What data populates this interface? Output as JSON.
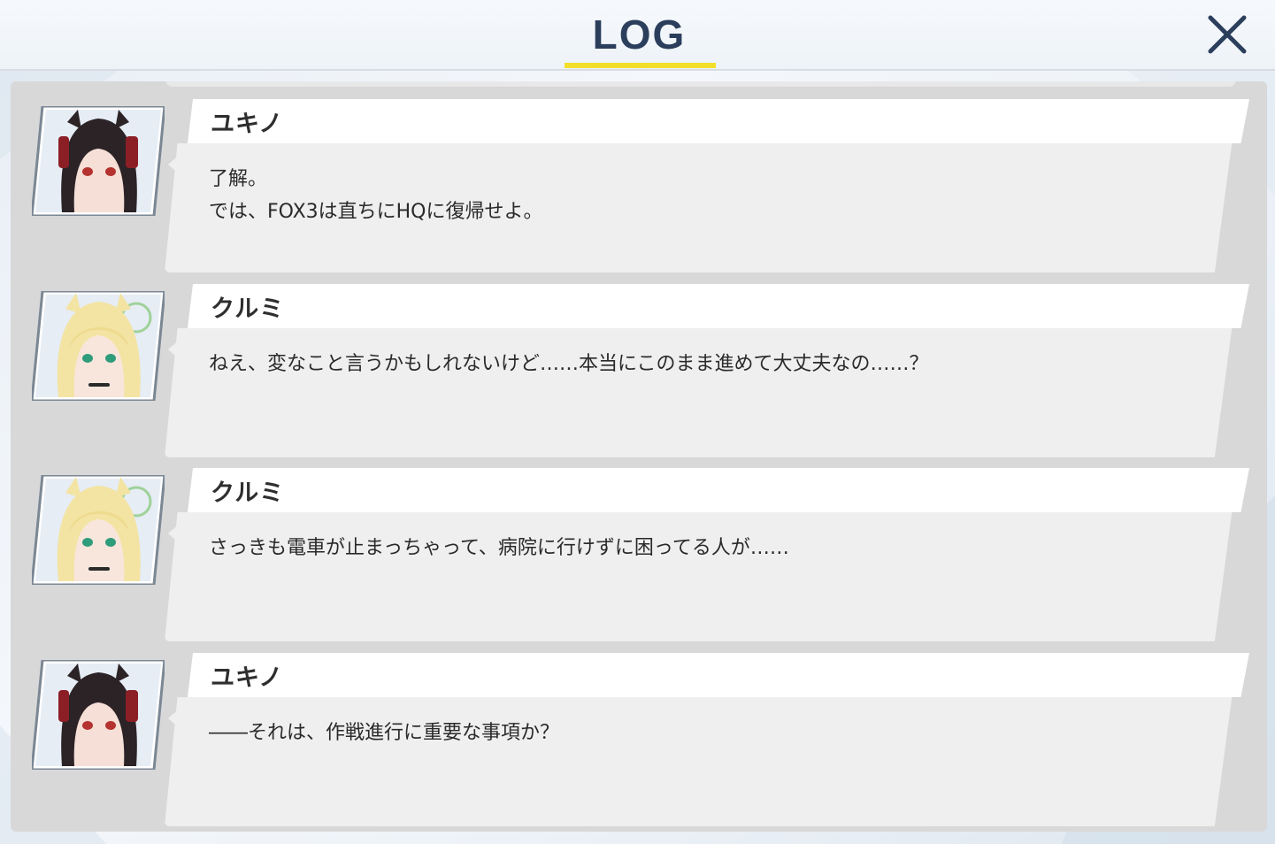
{
  "window": {
    "title": "LOG",
    "close_label": "×",
    "close_icon": "close-icon",
    "accent_color": "#f2df2a",
    "title_color": "#2b3f5c"
  },
  "log": {
    "entries": [
      {
        "speaker": "ユキノ",
        "portrait": "yukino-portrait",
        "message": "了解。\nでは、FOX3は直ちにHQに復帰せよ。"
      },
      {
        "speaker": "クルミ",
        "portrait": "kurumi-portrait",
        "message": "ねえ、変なこと言うかもしれないけど……本当にこのまま進めて大丈夫なの……？"
      },
      {
        "speaker": "クルミ",
        "portrait": "kurumi-portrait",
        "message": "さっきも電車が止まっちゃって、病院に行けずに困ってる人が……"
      },
      {
        "speaker": "ユキノ",
        "portrait": "yukino-portrait",
        "message": "――それは、作戦進行に重要な事項か？"
      }
    ]
  }
}
